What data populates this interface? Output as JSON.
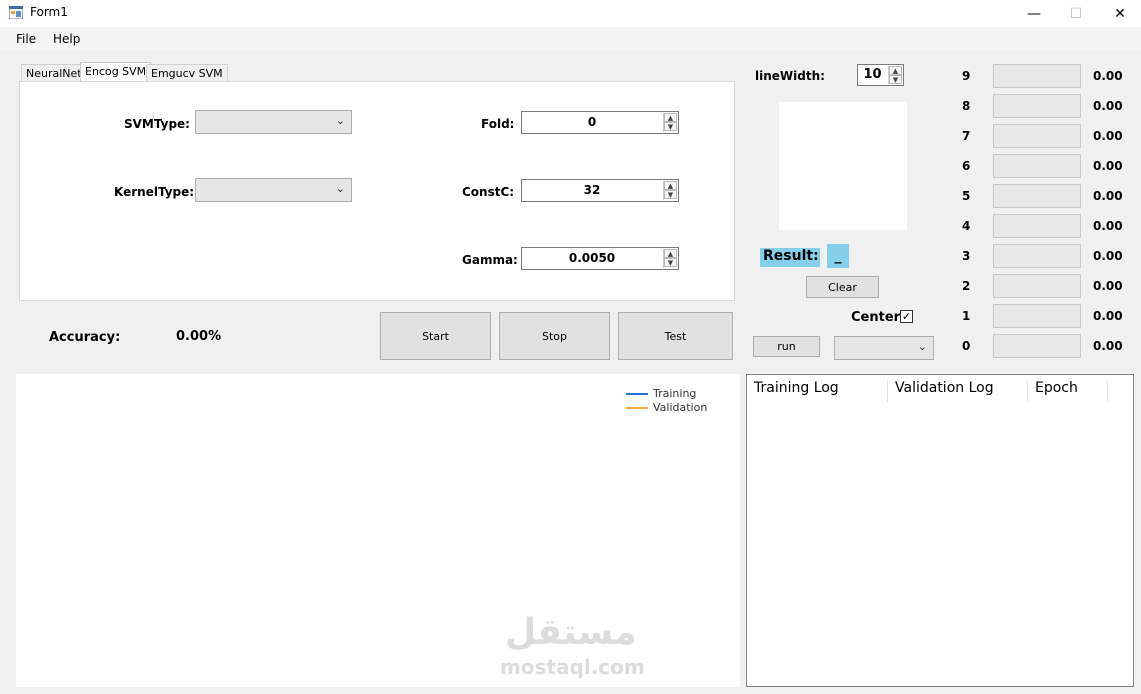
{
  "window": {
    "title": "Form1"
  },
  "menu": {
    "file": "File",
    "help": "Help"
  },
  "tabs": [
    {
      "label": "NeuralNet"
    },
    {
      "label": "Encog SVM"
    },
    {
      "label": "Emgucv SVM"
    }
  ],
  "svm": {
    "svm_type_label": "SVMType:",
    "svm_type_value": "",
    "kernel_type_label": "KernelType:",
    "kernel_type_value": "",
    "fold_label": "Fold:",
    "fold_value": "0",
    "constc_label": "ConstC:",
    "constc_value": "32",
    "gamma_label": "Gamma:",
    "gamma_value": "0.0050"
  },
  "accuracy": {
    "label": "Accuracy:",
    "value": "0.00%"
  },
  "buttons": {
    "start": "Start",
    "stop": "Stop",
    "test": "Test",
    "clear": "Clear",
    "run": "run"
  },
  "drawing": {
    "line_width_label": "lineWidth:",
    "line_width_value": "10",
    "result_label": "Result:",
    "result_value": "_",
    "center_label": "Center",
    "center_checked": true
  },
  "digits": [
    {
      "label": "9",
      "value": "0.00"
    },
    {
      "label": "8",
      "value": "0.00"
    },
    {
      "label": "7",
      "value": "0.00"
    },
    {
      "label": "6",
      "value": "0.00"
    },
    {
      "label": "5",
      "value": "0.00"
    },
    {
      "label": "4",
      "value": "0.00"
    },
    {
      "label": "3",
      "value": "0.00"
    },
    {
      "label": "2",
      "value": "0.00"
    },
    {
      "label": "1",
      "value": "0.00"
    },
    {
      "label": "0",
      "value": "0.00"
    }
  ],
  "chart": {
    "legend": [
      {
        "name": "Training",
        "color": "#1f77d4"
      },
      {
        "name": "Validation",
        "color": "#f4a341"
      }
    ]
  },
  "log": {
    "columns": [
      "Training Log",
      "Validation Log",
      "Epoch"
    ]
  },
  "watermark": {
    "arabic": "مستقل",
    "latin": "mostaql.com"
  }
}
